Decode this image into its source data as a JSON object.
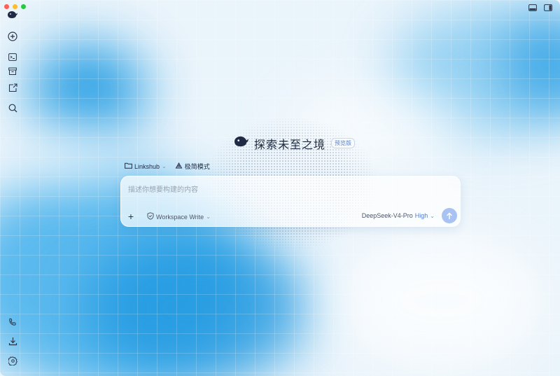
{
  "window": {
    "controls": [
      "close",
      "minimize",
      "maximize"
    ],
    "right_actions": [
      "panel-bottom-icon",
      "panel-right-icon"
    ]
  },
  "sidebar": {
    "logo": "whale-logo-icon",
    "top_items": [
      "new-chat-icon",
      "terminal-icon",
      "archive-icon",
      "share-icon",
      "search-icon"
    ],
    "bottom_items": [
      "phone-icon",
      "download-icon",
      "settings-icon"
    ]
  },
  "hero": {
    "title": "探索未至之境",
    "badge": "预览版"
  },
  "pickers": {
    "workspace_label": "Linkshub",
    "mode_label": "极简模式"
  },
  "composer": {
    "placeholder": "描述你想要构建的内容",
    "permission_label": "Workspace Write",
    "model_name": "DeepSeek-V4-Pro",
    "model_level": "High"
  },
  "colors": {
    "accent": "#4f7bd6",
    "send_button": "#a8c3f2",
    "background_blue": "#1e9be3"
  }
}
